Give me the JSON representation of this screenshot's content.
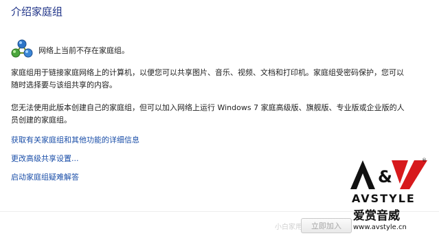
{
  "page": {
    "title": "介绍家庭组",
    "status_text": "网络上当前不存在家庭组。",
    "paragraph_1": "家庭组用于链接家庭网络上的计算机，以便您可以共享图片、音乐、视频、文档和打印机。家庭组受密码保护，您可以随时选择要与该组共享的内容。",
    "paragraph_2": "您无法使用此版本创建自己的家庭组，但可以加入网络上运行 Windows 7 家庭高级版、旗舰版、专业版或企业版的人员创建的家庭组。"
  },
  "links": {
    "more_info": "获取有关家庭组和其他功能的详细信息",
    "advanced_sharing": "更改高级共享设置...",
    "troubleshooter": "启动家庭组疑难解答"
  },
  "buttons": {
    "join_now": "立即加入"
  },
  "watermark": {
    "logo_mark": "A&V",
    "brand": "AVSTYLE",
    "brand_cn": "爱赏音威",
    "url": "www.avstyle.cn",
    "faint_text": "小白家用"
  },
  "icons": {
    "network": "homegroup-network-icon"
  },
  "colors": {
    "title": "#1e3287",
    "link": "#1a4ea8",
    "text": "#1e1e1e",
    "disabled": "#a6a6a6",
    "logo_red": "#d7191c"
  }
}
